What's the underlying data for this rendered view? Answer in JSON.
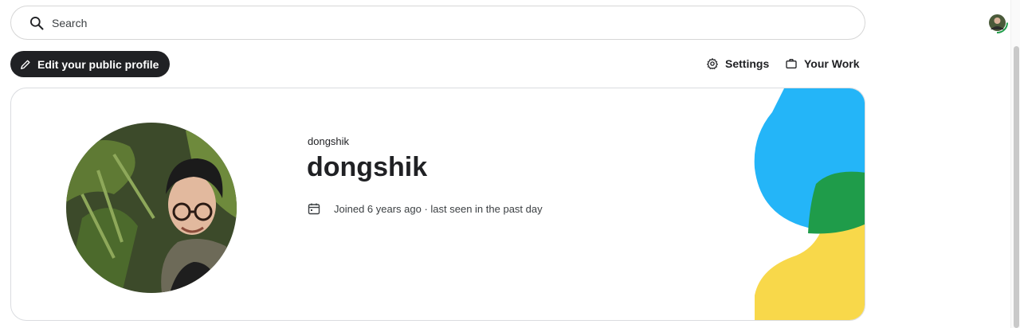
{
  "search": {
    "placeholder": "Search"
  },
  "toolbar": {
    "edit_label": "Edit your public profile",
    "settings_label": "Settings",
    "work_label": "Your Work"
  },
  "profile": {
    "username_small": "dongshik",
    "display_name": "dongshik",
    "joined_text": "Joined 6 years ago · last seen in the past day"
  },
  "colors": {
    "blue": "#24b5f8",
    "green": "#1f9c4a",
    "yellow": "#f8d84a",
    "dark": "#202124"
  }
}
